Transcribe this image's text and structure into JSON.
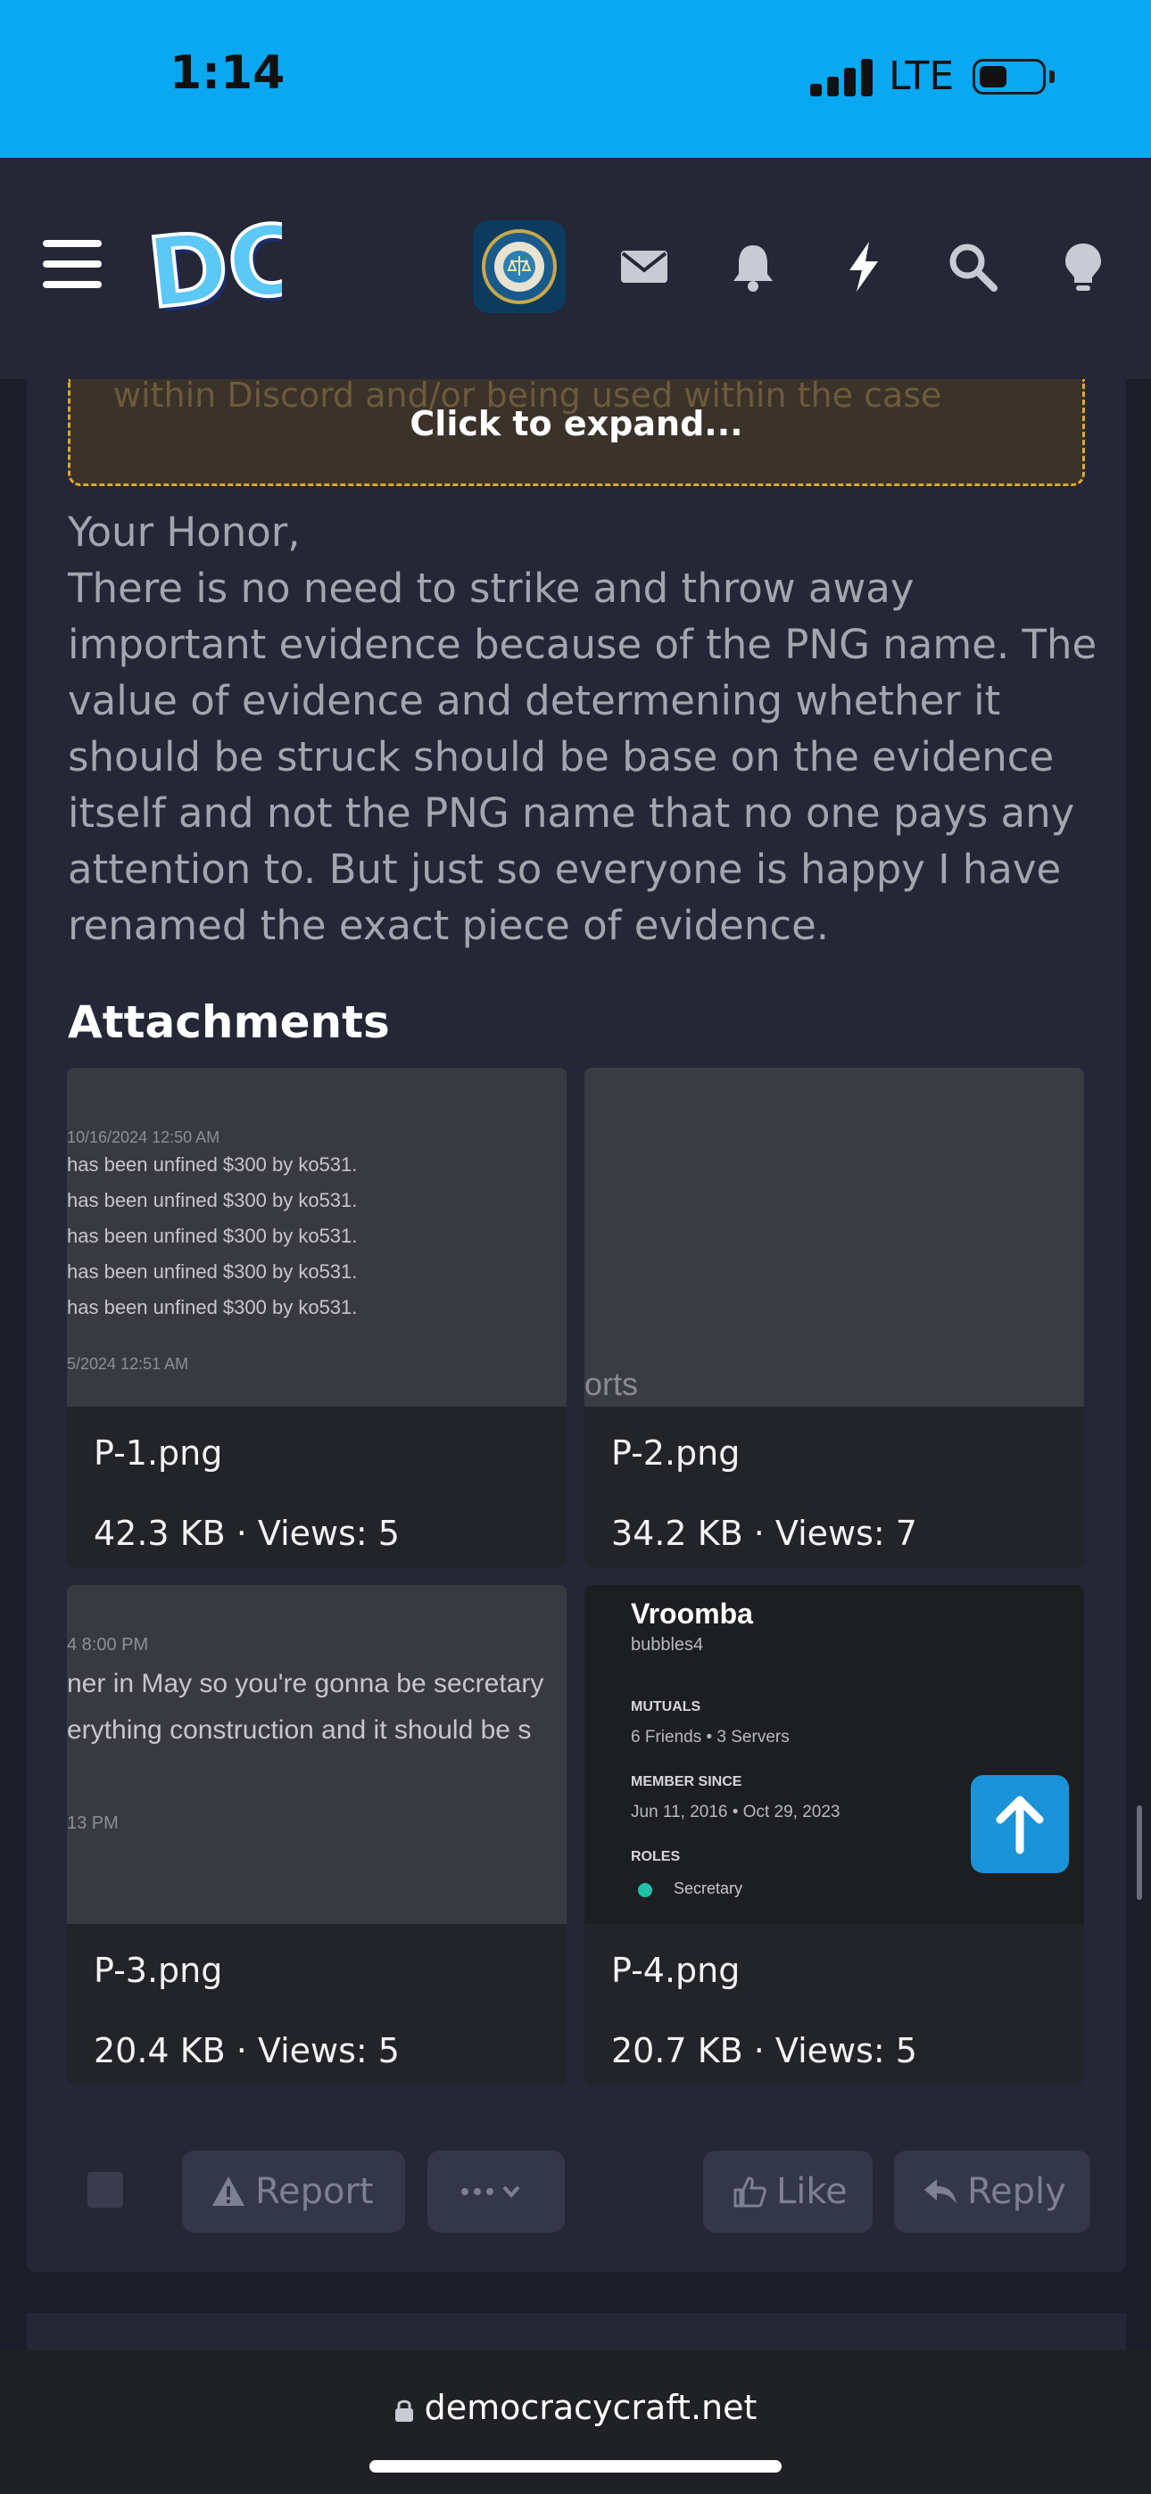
{
  "status_bar": {
    "time": "1:14",
    "network": "LTE"
  },
  "nav": {
    "logo": "DC",
    "icons": [
      "menu-icon",
      "avatar",
      "envelope-icon",
      "bell-icon",
      "bolt-icon",
      "search-icon",
      "lightbulb-icon"
    ]
  },
  "quote": {
    "faded_text": "within Discord and/or being used within the case",
    "expand_label": "Click to expand..."
  },
  "post": {
    "paragraphs": [
      "Your Honor,",
      "There is no need to strike and throw away important evidence because of the PNG name. The value of evidence and determening whether it should be struck should be base on the evidence itself and not the PNG name that no one pays any attention to. But just so everyone is happy I have renamed the exact piece of evidence."
    ],
    "attachments_title": "Attachments",
    "attachments": [
      {
        "name": "P-1.png",
        "meta": "42.3 KB · Views: 5"
      },
      {
        "name": "P-2.png",
        "meta": "34.2 KB · Views: 7"
      },
      {
        "name": "P-3.png",
        "meta": "20.4 KB · Views: 5"
      },
      {
        "name": "P-4.png",
        "meta": "20.7 KB · Views: 5"
      }
    ],
    "thumb1": {
      "date1": "10/16/2024 12:50 AM",
      "row": "has been unfined $300 by ko531.",
      "date2": "5/2024 12:51 AM"
    },
    "thumb2": {
      "word": "orts"
    },
    "thumb3": {
      "date1": "4 8:00 PM",
      "line1": "ner in May so you're gonna be secretary",
      "line2": "erything construction and it should be s",
      "date2": "13 PM"
    },
    "thumb4": {
      "name": "Vroomba",
      "handle": "bubbles4",
      "mutuals_label": "MUTUALS",
      "mutuals": "6 Friends  •  3 Servers",
      "member_label": "MEMBER SINCE",
      "member": "Jun 11, 2016  •  Oct 29, 2023",
      "roles_label": "ROLES",
      "role": "Secretary"
    },
    "actions": {
      "report": "Report",
      "like": "Like",
      "reply": "Reply"
    }
  },
  "url_bar": {
    "url": "democracycraft.net"
  },
  "colors": {
    "status_bar": "#0aa8f0",
    "nav": "#252636",
    "background": "#1c1d29",
    "quote_border": "#e0a82e",
    "accent": "#1a93d9"
  }
}
